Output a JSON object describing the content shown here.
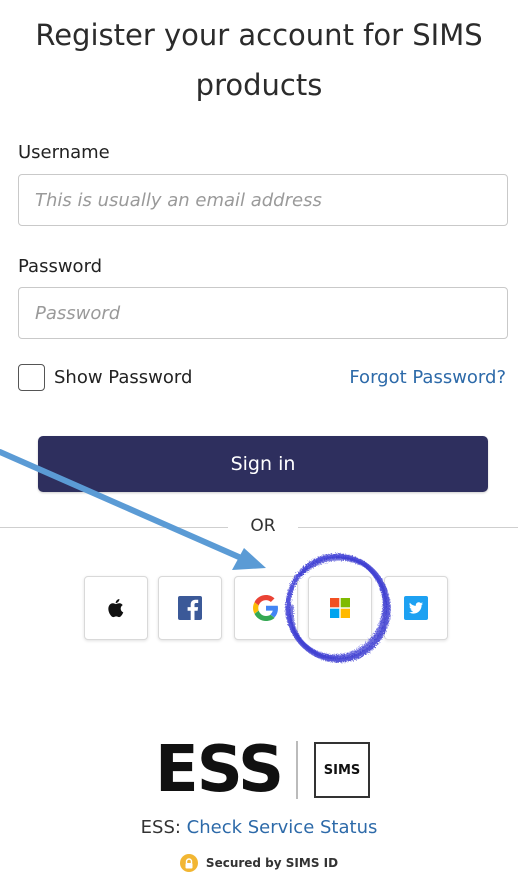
{
  "heading": {
    "line1": "Register your account for SIMS",
    "line2": "products"
  },
  "form": {
    "username_label": "Username",
    "username_placeholder": "This is usually an email address",
    "username_value": "",
    "password_label": "Password",
    "password_placeholder": "Password",
    "password_value": "",
    "show_password_label": "Show Password",
    "show_password_checked": false,
    "forgot_password_link": "Forgot Password?",
    "signin_label": "Sign in"
  },
  "separator": {
    "label": "OR"
  },
  "social_login": [
    {
      "provider": "Apple",
      "icon": "apple-icon"
    },
    {
      "provider": "Facebook",
      "icon": "facebook-icon"
    },
    {
      "provider": "Google",
      "icon": "google-icon"
    },
    {
      "provider": "Microsoft",
      "icon": "microsoft-icon"
    },
    {
      "provider": "Twitter",
      "icon": "twitter-icon"
    }
  ],
  "footer": {
    "logo_text": "ESS",
    "sims_badge": "SIMS",
    "service_prefix": "ESS: ",
    "service_link": "Check Service Status",
    "secured_text": "Secured by SIMS ID"
  },
  "colors": {
    "signin_button": "#2e2f5e",
    "link": "#2d6aa9",
    "annotation_arrow": "#5b9bd5",
    "annotation_circle": "#3a3ad0",
    "lock_badge": "#f2b632"
  },
  "annotations": {
    "arrow": "pointer toward Google button",
    "circle": "hand-drawn circle around Microsoft button"
  }
}
